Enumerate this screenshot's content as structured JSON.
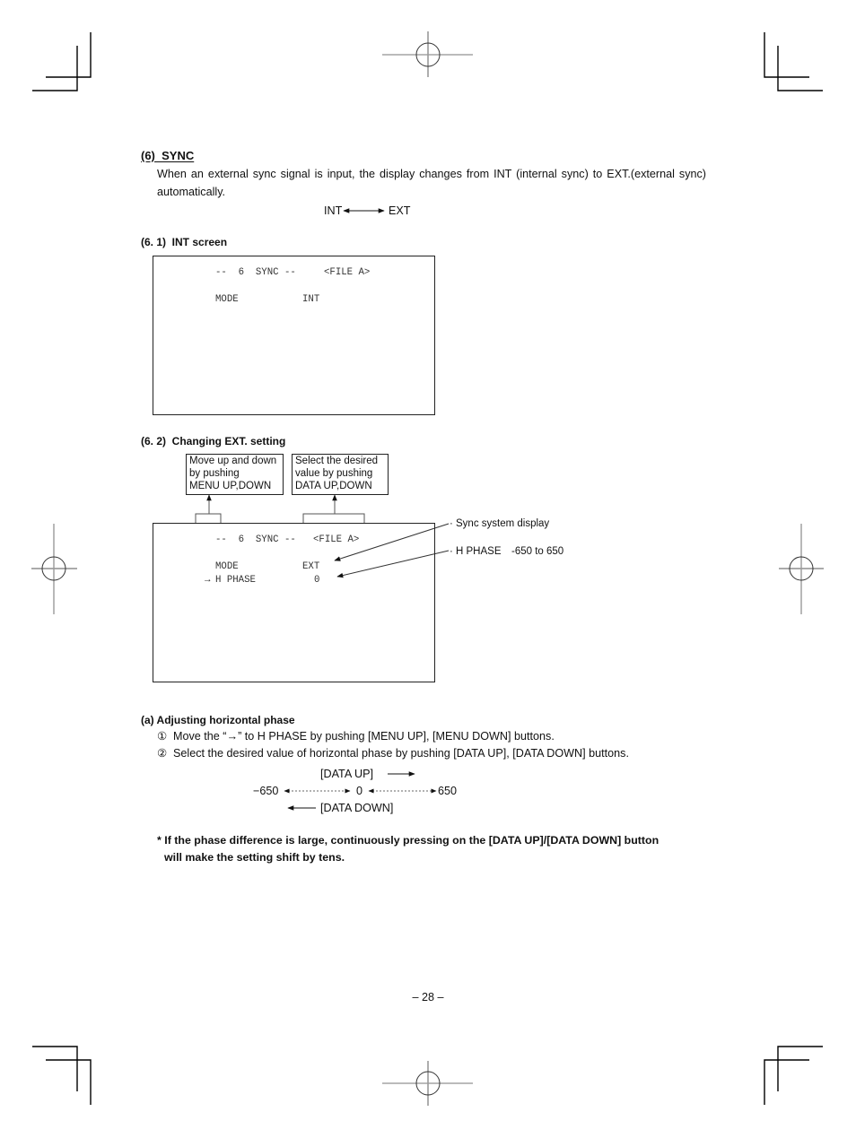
{
  "section": {
    "heading": "(6)  SYNC",
    "intro_line1": "When an external sync signal is input, the display changes from INT (internal sync) to EXT.(external sync)",
    "intro_line2": "automatically.",
    "mode_diagram": {
      "left": "INT",
      "right": "EXT"
    }
  },
  "int_screen": {
    "heading": "(6. 1)  INT screen",
    "title": "--  6  SYNC --",
    "file": "<FILE A>",
    "rows": [
      {
        "label": "MODE",
        "value": "INT"
      }
    ]
  },
  "ext_screen": {
    "heading": "(6. 2)  Changing EXT. setting",
    "callouts": [
      {
        "lines": [
          "Move up and down",
          "by pushing",
          "MENU UP,DOWN"
        ]
      },
      {
        "lines": [
          "Select the desired",
          "value by pushing",
          "DATA UP,DOWN"
        ]
      }
    ],
    "title": "--  6  SYNC --",
    "file": "<FILE A>",
    "rows": [
      {
        "cursor": "",
        "label": "MODE",
        "value": "EXT"
      },
      {
        "cursor": "→",
        "label": "H PHASE",
        "value": "0"
      }
    ],
    "annotations": [
      {
        "bullet": "·",
        "label": "Sync system display",
        "range": ""
      },
      {
        "bullet": "·",
        "label": "H PHASE",
        "range": "-650 to 650"
      }
    ]
  },
  "adjust": {
    "heading": "(a) Adjusting horizontal phase",
    "steps": [
      {
        "marker": "①",
        "text": "Move the “→” to H PHASE by pushing [MENU UP], [MENU DOWN] buttons."
      },
      {
        "marker": "②",
        "text": "Select the desired value of horizontal phase by pushing [DATA UP], [DATA DOWN] buttons."
      }
    ],
    "range_diagram": {
      "up_label": "[DATA UP]",
      "down_label": "[DATA DOWN]",
      "min": "−650",
      "center": "0",
      "max": "650"
    },
    "note_line1": "* If the phase difference is large, continuously pressing on the [DATA UP]/[DATA DOWN] button",
    "note_line2": "will make the setting shift by tens."
  },
  "footer": {
    "page_number": "– 28 –"
  }
}
